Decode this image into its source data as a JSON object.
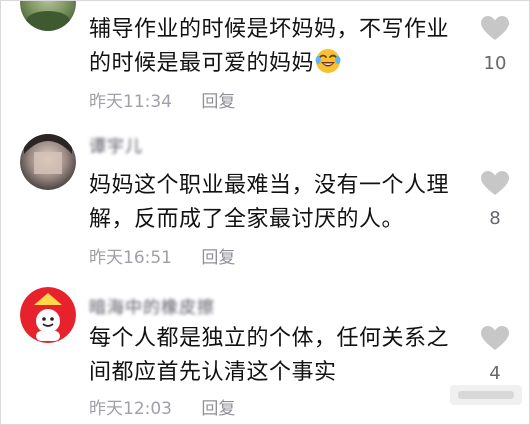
{
  "comments": [
    {
      "username": "",
      "text_line1": "辅导作业的时候是坏妈妈，不写作业",
      "text_line2": "的时候是最可爱的妈妈",
      "emoji": "laughing-crying-emoji",
      "time": "昨天11:34",
      "reply_label": "回复",
      "likes": "10"
    },
    {
      "username": "谭宇儿",
      "text_line1": "妈妈这个职业最难当，没有一个人理",
      "text_line2": "解，反而成了全家最讨厌的人。",
      "time": "昨天16:51",
      "reply_label": "回复",
      "likes": "8"
    },
    {
      "username": "暗海中的橡皮擦",
      "text_line1": "每个人都是独立的个体，任何关系之",
      "text_line2": "间都应首先认清这个事实",
      "time": "昨天12:03",
      "reply_label": "回复",
      "likes": "4"
    }
  ],
  "icons": {
    "like": "heart-icon",
    "avatar_3_badge": "red-hat-icon"
  },
  "colors": {
    "text": "#121212",
    "meta": "#a0a0a8",
    "heart": "#c7c7c7",
    "avatar_red": "#e8222c"
  }
}
